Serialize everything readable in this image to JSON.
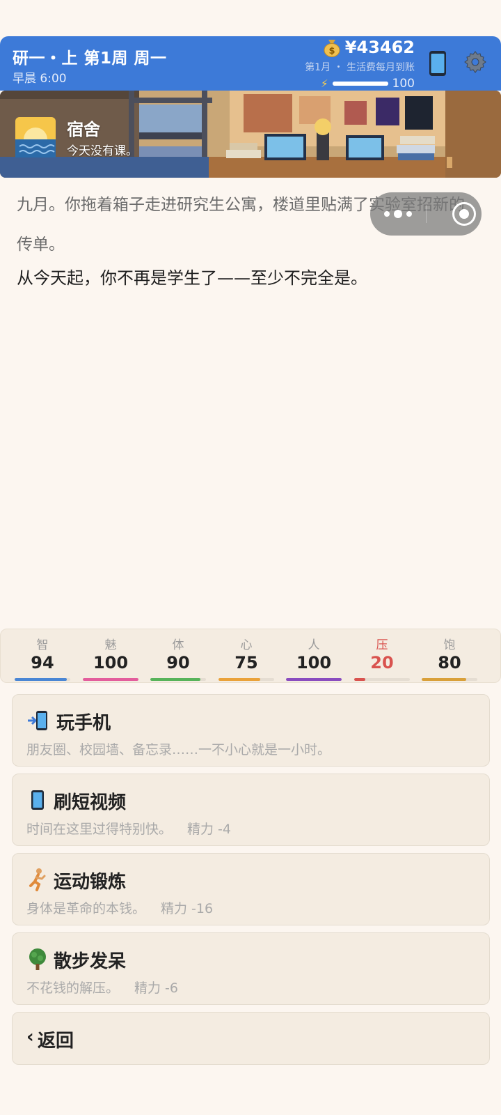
{
  "header": {
    "title": "研一・上 第1周 周一",
    "time": "早晨 6:00",
    "money": "¥43462",
    "allowance": "第1月 ・ 生活费每月到账",
    "energy": "100",
    "energy_fraction": 1.0
  },
  "location": {
    "name": "宿舍",
    "subtitle": "今天没有课。",
    "icon": "sunrise-icon"
  },
  "story": {
    "line1": "九月。你拖着箱子走进研究生公寓，楼道里贴满了实验室招新的传单。",
    "line2": "从今天起，你不再是学生了——至少不完全是。"
  },
  "stats": [
    {
      "label": "智",
      "value": "94",
      "fraction": 0.94,
      "color": "#4a86d4",
      "label_color": "#9a9a9a"
    },
    {
      "label": "魅",
      "value": "100",
      "fraction": 1.0,
      "color": "#e35d9c",
      "label_color": "#9a9a9a"
    },
    {
      "label": "体",
      "value": "90",
      "fraction": 0.9,
      "color": "#57b35a",
      "label_color": "#9a9a9a"
    },
    {
      "label": "心",
      "value": "75",
      "fraction": 0.75,
      "color": "#eaa23a",
      "label_color": "#9a9a9a"
    },
    {
      "label": "人",
      "value": "100",
      "fraction": 1.0,
      "color": "#8a4cbf",
      "label_color": "#9a9a9a"
    },
    {
      "label": "压",
      "value": "20",
      "fraction": 0.2,
      "color": "#d9534f",
      "label_color": "#d9534f",
      "value_color": "#d9534f"
    },
    {
      "label": "饱",
      "value": "80",
      "fraction": 0.8,
      "color": "#d9a03a",
      "label_color": "#9a9a9a"
    }
  ],
  "actions": [
    {
      "title": "玩手机",
      "desc": "朋友圈、校园墙、备忘录……一不小心就是一小时。",
      "cost": "",
      "icon": "phone-in-icon"
    },
    {
      "title": "刷短视频",
      "desc": "时间在这里过得特别快。",
      "cost": "精力 -4",
      "icon": "mobile-phone-icon"
    },
    {
      "title": "运动锻炼",
      "desc": "身体是革命的本钱。",
      "cost": "精力 -16",
      "icon": "running-icon"
    },
    {
      "title": "散步发呆",
      "desc": "不花钱的解压。",
      "cost": "精力 -6",
      "icon": "tree-icon"
    }
  ],
  "back": {
    "label": "返回"
  }
}
